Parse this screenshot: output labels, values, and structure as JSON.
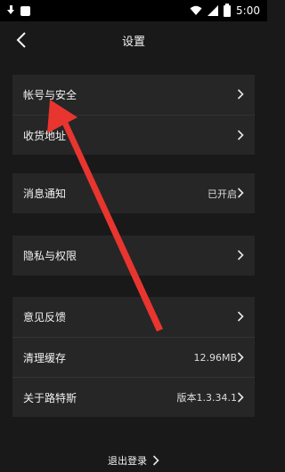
{
  "status_bar": {
    "time": "5:00"
  },
  "nav": {
    "title": "设置"
  },
  "groups": [
    {
      "rows": [
        {
          "label": "帐号与安全"
        },
        {
          "label": "收货地址"
        }
      ]
    },
    {
      "rows": [
        {
          "label": "消息通知",
          "value": "已开启"
        }
      ]
    },
    {
      "rows": [
        {
          "label": "隐私与权限"
        }
      ]
    },
    {
      "rows": [
        {
          "label": "意见反馈"
        },
        {
          "label": "清理缓存",
          "value": "12.96MB"
        },
        {
          "label": "关于路特斯",
          "value": "版本1.3.34.1"
        }
      ]
    }
  ],
  "footer": {
    "logout_label": "退出登录"
  },
  "colors": {
    "background": "#191919",
    "card": "#262626",
    "arrow": "#e8352f"
  }
}
